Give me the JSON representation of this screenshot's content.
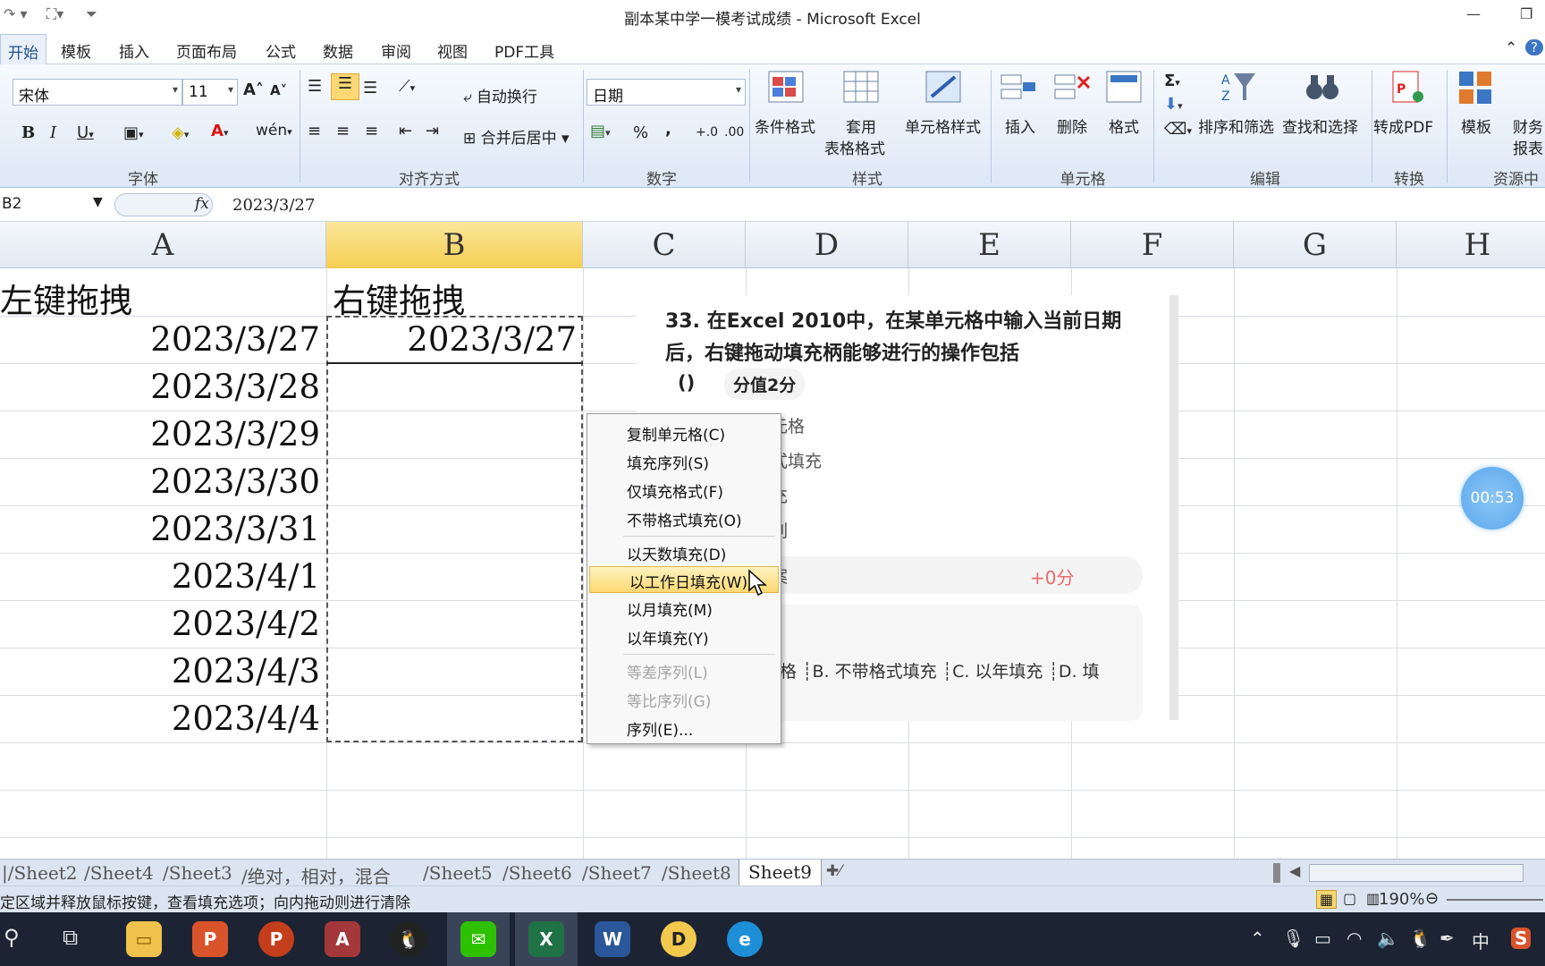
{
  "window": {
    "title": "副本某中学一模考试成绩 - Microsoft Excel"
  },
  "ribbon_tabs": [
    "开始",
    "模板",
    "插入",
    "页面布局",
    "公式",
    "数据",
    "审阅",
    "视图",
    "PDF工具"
  ],
  "ribbon": {
    "font_name": "宋体",
    "font_size": "11",
    "wrap_text": "自动换行",
    "merge_center": "合并后居中",
    "number_format": "日期",
    "percent": "%",
    "comma": ",",
    "groups": {
      "font": "字体",
      "align": "对齐方式",
      "number": "数字",
      "style": "样式",
      "cells": "单元格",
      "edit": "编辑",
      "convert": "转换",
      "resource": "资源中"
    },
    "buttons": {
      "cond_format": "条件格式",
      "table_format_1": "套用",
      "table_format_2": "表格格式",
      "cell_style": "单元格样式",
      "insert": "插入",
      "delete": "删除",
      "format": "格式",
      "sort_filter": "排序和筛选",
      "find_select": "查找和选择",
      "to_pdf": "转成PDF",
      "template": "模板",
      "finance_1": "财务",
      "finance_2": "报表"
    }
  },
  "formula_bar": {
    "name_box": "B2",
    "value": "2023/3/27"
  },
  "columns": [
    "A",
    "B",
    "C",
    "D",
    "E",
    "F",
    "G",
    "H"
  ],
  "cells": {
    "a1": "左键拖拽",
    "b1": "右键拖拽",
    "b2": "2023/3/27",
    "col_a_dates": [
      "2023/3/27",
      "2023/3/28",
      "2023/3/29",
      "2023/3/30",
      "2023/3/31",
      "2023/4/1",
      "2023/4/2",
      "2023/4/3",
      "2023/4/4"
    ]
  },
  "quiz": {
    "question": "33. 在Excel 2010中，在某单元格中输入当前日期后，右键拖动填充柄能够进行的操作包括",
    "blank": "()",
    "score": "分值2分",
    "option_fragments": [
      "元格",
      "式填充",
      "充",
      "列"
    ],
    "result_fragment": "案",
    "points": "+0分",
    "answer_fragment": "格 ┊B. 不带格式填充 ┊C. 以年填充 ┊D. 填"
  },
  "context_menu": [
    {
      "label": "复制单元格(C)",
      "state": "normal"
    },
    {
      "label": "填充序列(S)",
      "state": "normal"
    },
    {
      "label": "仅填充格式(F)",
      "state": "normal"
    },
    {
      "label": "不带格式填充(O)",
      "state": "normal"
    },
    {
      "label": "以天数填充(D)",
      "state": "normal"
    },
    {
      "label": "以工作日填充(W)",
      "state": "highlighted"
    },
    {
      "label": "以月填充(M)",
      "state": "normal"
    },
    {
      "label": "以年填充(Y)",
      "state": "normal"
    },
    {
      "label": "等差序列(L)",
      "state": "disabled"
    },
    {
      "label": "等比序列(G)",
      "state": "disabled"
    },
    {
      "label": "序列(E)...",
      "state": "normal"
    }
  ],
  "timer": "00:53",
  "sheet_tabs": [
    "Sheet2",
    "Sheet4",
    "Sheet3",
    "绝对，相对，混合",
    "Sheet5",
    "Sheet6",
    "Sheet7",
    "Sheet8",
    "Sheet9"
  ],
  "active_sheet": "Sheet9",
  "status": {
    "message": "定区域并释放鼠标按键，查看填充选项；向内拖动则进行清除",
    "zoom": "190%"
  },
  "taskbar": {
    "ime": "中",
    "colors": {
      "accent": "#5aa7ee",
      "excel_green": "#1f7246",
      "menu_highlight": "#fbd873"
    }
  }
}
